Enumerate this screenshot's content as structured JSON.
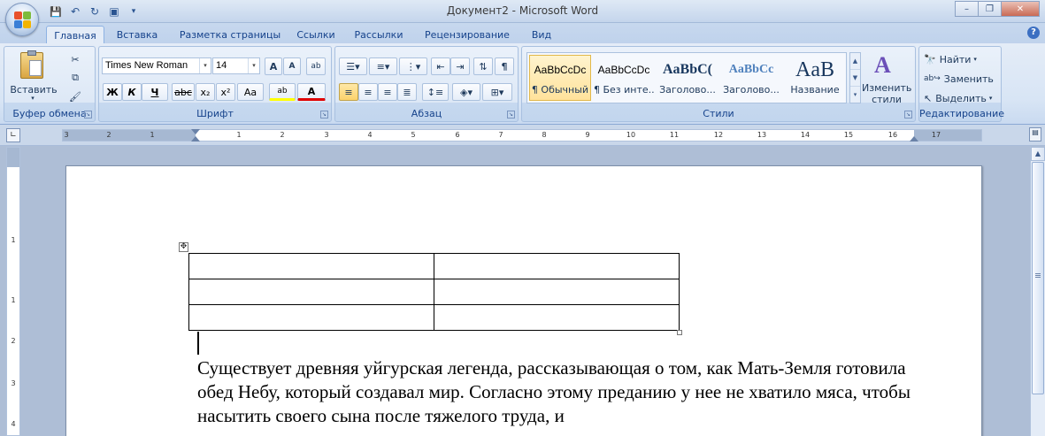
{
  "window": {
    "title": "Документ2 - Microsoft Word",
    "controls": {
      "minimize": "–",
      "maximize": "❐",
      "close": "✕"
    }
  },
  "quick_access": [
    {
      "icon": "save-icon",
      "glyph": "💾"
    },
    {
      "icon": "undo-icon",
      "glyph": "↶"
    },
    {
      "icon": "redo-icon",
      "glyph": "↻"
    },
    {
      "icon": "print-preview-icon",
      "glyph": "▣"
    },
    {
      "icon": "customize-icon",
      "glyph": "▾"
    }
  ],
  "tabs": [
    "Главная",
    "Вставка",
    "Разметка страницы",
    "Ссылки",
    "Рассылки",
    "Рецензирование",
    "Вид"
  ],
  "ribbon": {
    "clipboard": {
      "label": "Буфер обмена",
      "paste": "Вставить"
    },
    "font": {
      "label": "Шрифт",
      "family": "Times New Roman",
      "size": "14",
      "grow": "A",
      "shrink": "A",
      "clear": "ab",
      "bold": "Ж",
      "italic": "К",
      "underline": "Ч",
      "strike": "abc",
      "subscript": "x₂",
      "superscript": "x²",
      "case": "Aa",
      "highlight": "ab",
      "color": "A"
    },
    "paragraph": {
      "label": "Абзац",
      "show_marks": "¶"
    },
    "styles": {
      "label": "Стили",
      "items": [
        {
          "preview": "AaBbCcDc",
          "name": "¶ Обычный"
        },
        {
          "preview": "AaBbCcDc",
          "name": "¶ Без инте..."
        },
        {
          "preview": "AaBbC(",
          "name": "Заголово..."
        },
        {
          "preview": "AaBbCc",
          "name": "Заголово..."
        },
        {
          "preview": "AaB",
          "name": "Название"
        }
      ],
      "change": "Изменить стили"
    },
    "editing": {
      "label": "Редактирование",
      "find": "Найти",
      "replace": "Заменить",
      "select": "Выделить"
    }
  },
  "ruler": {
    "numbers": [
      "3",
      "2",
      "1",
      "1",
      "2",
      "3",
      "4",
      "5",
      "6",
      "7",
      "8",
      "9",
      "10",
      "11",
      "12",
      "13",
      "14",
      "15",
      "16",
      "17"
    ]
  },
  "vruler": {
    "numbers": [
      "1",
      "1",
      "2",
      "3",
      "4"
    ]
  },
  "document": {
    "text": "Существует древняя уйгурская легенда, рассказывающая о том, как Мать-Земля готовила обед Небу, который создавал мир. Согласно этому преданию у нее не хватило мяса, чтобы насытить своего сына после тяжелого труда, и"
  }
}
